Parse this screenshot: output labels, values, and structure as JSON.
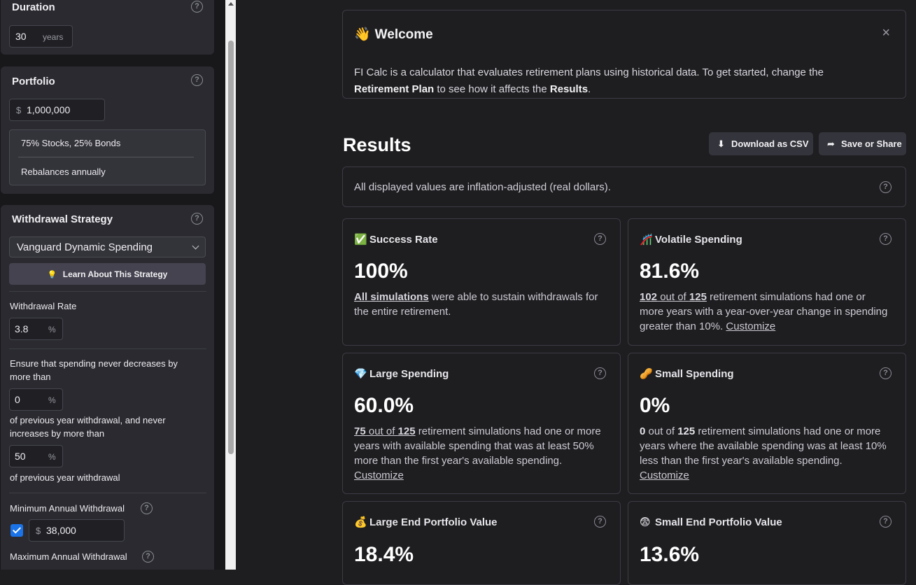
{
  "sidebar": {
    "duration": {
      "title": "Duration",
      "value": "30",
      "suffix": "years"
    },
    "portfolio": {
      "title": "Portfolio",
      "currency": "$",
      "value": "1,000,000",
      "allocation": "75% Stocks, 25% Bonds",
      "rebalance": "Rebalances annually"
    },
    "withdrawal": {
      "title": "Withdrawal Strategy",
      "strategy_selected": "Vanguard Dynamic Spending",
      "learn_button": "Learn About This Strategy",
      "rate_label": "Withdrawal Rate",
      "rate_value": "3.8",
      "pct": "%",
      "decrease_label": "Ensure that spending never decreases by more than",
      "decrease_value": "0",
      "increase_label": "of previous year withdrawal, and never increases by more than",
      "increase_value": "50",
      "tail_label": "of previous year withdrawal",
      "min_label": "Minimum Annual Withdrawal",
      "min_checked": true,
      "min_currency": "$",
      "min_value": "38,000",
      "max_label": "Maximum Annual Withdrawal"
    },
    "help_glyph": "?"
  },
  "welcome": {
    "emoji": "👋",
    "title": "Welcome",
    "text_before": "FI Calc is a calculator that evaluates retirement plans using historical data. To get started, change the ",
    "bold1": "Retirement Plan",
    "text_middle": " to see how it affects the ",
    "bold2": "Results",
    "text_after": ".",
    "close": "×"
  },
  "results": {
    "title": "Results",
    "download_label": "Download as CSV",
    "share_label": "Save or Share",
    "note": "All displayed values are inflation-adjusted (real dollars)."
  },
  "stats": {
    "success": {
      "emoji": "✅",
      "title": "Success Rate",
      "value": "100%",
      "link": "All simulations",
      "desc": " were able to sustain withdrawals for the entire retirement."
    },
    "volatile": {
      "emoji": "🎢",
      "title": "Volatile Spending",
      "value": "81.6%",
      "count": "102",
      "of": " out of ",
      "total": "125",
      "desc": " retirement simulations had one or more years with a year-over-year change in spending greater than 10%. ",
      "customize": "Customize"
    },
    "large": {
      "emoji": "💎",
      "title": "Large Spending",
      "value": "60.0%",
      "count": "75",
      "of": " out of ",
      "total": "125",
      "desc": " retirement simulations had one or more years with available spending that was at least 50% more than the first year's available spending. ",
      "customize": "Customize"
    },
    "small": {
      "emoji": "🥜",
      "title": "Small Spending",
      "value": "0%",
      "count": "0",
      "of": " out of ",
      "total": "125",
      "desc": " retirement simulations had one or more years where the available spending was at least 10% less than the first year's available spending. ",
      "customize": "Customize"
    },
    "large_end": {
      "emoji": "💰",
      "title": "Large End Portfolio Value",
      "value": "18.4%"
    },
    "small_end": {
      "emoji": "😨",
      "title": "Small End Portfolio Value",
      "value": "13.6%"
    }
  }
}
